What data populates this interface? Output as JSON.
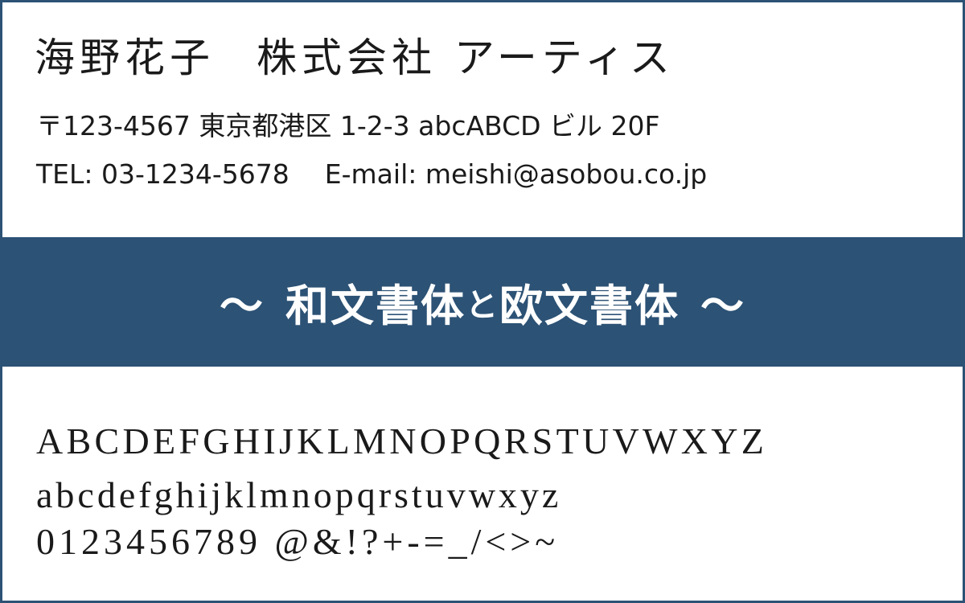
{
  "card": {
    "name": "海野花子",
    "company": "株式会社 アーティス",
    "address": "〒123-4567 東京都港区 1-2-3 abcABCD ビル 20F",
    "tel": "TEL: 03-1234-5678",
    "email": "E-mail: meishi@asobou.co.jp"
  },
  "banner": {
    "wave_left": "～",
    "title_part1": "和文書体",
    "title_connector": "と",
    "title_part2": "欧文書体",
    "wave_right": "～",
    "background_color": "#2c5275",
    "text_color": "#ffffff"
  },
  "sample": {
    "uppercase": "ABCDEFGHIJKLMNOPQRSTUVWXYZ",
    "lowercase": "abcdefghijklmnopqrstuvwxyz",
    "digits_symbols": "0123456789 @&!?+-=_/<>~"
  }
}
